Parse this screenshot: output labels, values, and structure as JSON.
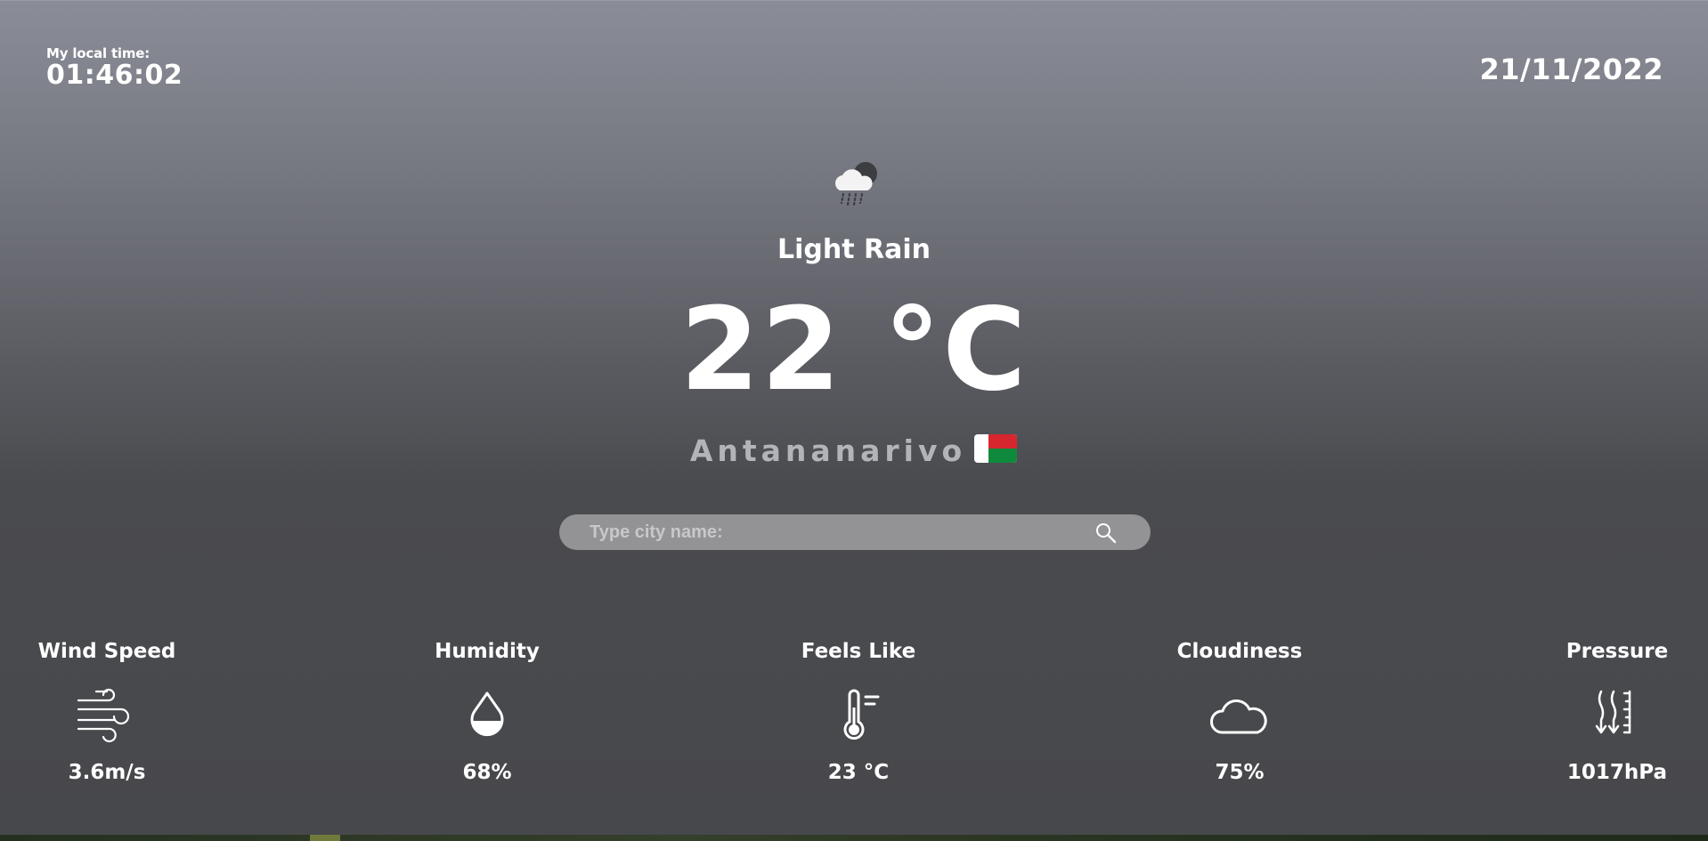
{
  "header": {
    "local_time_label": "My local time:",
    "local_time_value": "01:46:02",
    "date": "21/11/2022"
  },
  "weather": {
    "icon": "cloud-rain-moon-icon",
    "condition": "Light Rain",
    "temperature": "22 °C",
    "city": "Antananarivo",
    "country_flag": "madagascar-flag"
  },
  "search": {
    "placeholder": "Type city name:",
    "value": "",
    "icon": "search-icon"
  },
  "stats": [
    {
      "title": "Wind Speed",
      "icon": "wind-icon",
      "value": "3.6m/s"
    },
    {
      "title": "Humidity",
      "icon": "water-drop-icon",
      "value": "68%"
    },
    {
      "title": "Feels Like",
      "icon": "thermometer-icon",
      "value": "23 °C"
    },
    {
      "title": "Cloudiness",
      "icon": "cloud-icon",
      "value": "75%"
    },
    {
      "title": "Pressure",
      "icon": "pressure-icon",
      "value": "1017hPa"
    }
  ],
  "colors": {
    "background_top": "#8a8d97",
    "background_bottom": "#47484c",
    "text": "#ffffff",
    "city_text": "#b3b4b8",
    "search_bg": "#939396"
  }
}
